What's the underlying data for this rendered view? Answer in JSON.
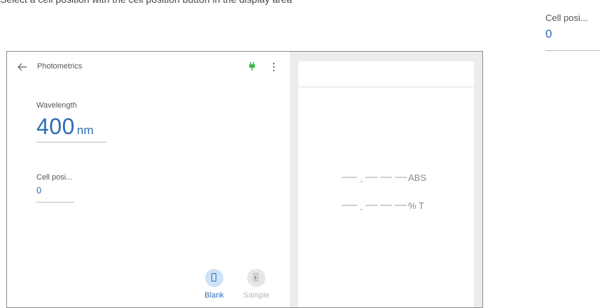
{
  "doc": {
    "top_text": "Select a cell position with the cell position button in the display area"
  },
  "callout": {
    "label": "Cell posi...",
    "value": "0"
  },
  "appbar": {
    "title": "Photometrics"
  },
  "wavelength": {
    "label": "Wavelength",
    "value": "400",
    "unit": "nm"
  },
  "cell_position": {
    "label": "Cell posi...",
    "value": "0"
  },
  "mode_buttons": {
    "blank_label": "Blank",
    "sample_label": "Sample",
    "selected": "Blank"
  },
  "readouts": {
    "abs_unit": "ABS",
    "t_unit": "% T"
  },
  "colors": {
    "accent": "#2f6db5",
    "plug": "#3cb54a",
    "selected_bg": "#cfe3f7"
  },
  "icons": [
    "back-arrow-icon",
    "plug-icon",
    "more-vert-icon",
    "cuvette-icon"
  ]
}
